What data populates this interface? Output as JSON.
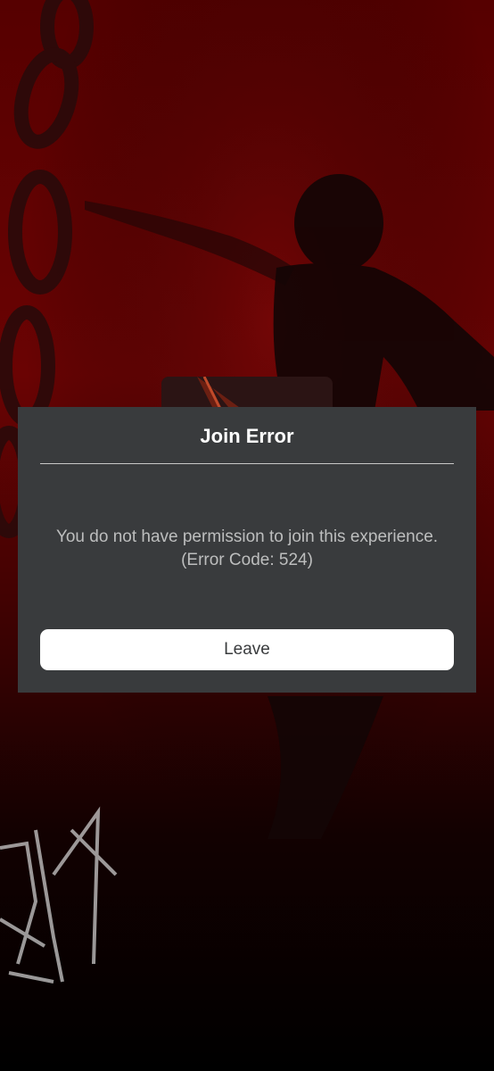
{
  "dialog": {
    "title": "Join Error",
    "message_line1": "You do not have permission to join this experience.",
    "message_line2": "(Error Code: 524)",
    "leave_label": "Leave"
  },
  "colors": {
    "background_red": "#5a0000",
    "modal_background": "#393b3d",
    "button_background": "#ffffff",
    "button_text": "#393b3d",
    "title_text": "#ffffff",
    "message_text": "#bdbebe"
  }
}
